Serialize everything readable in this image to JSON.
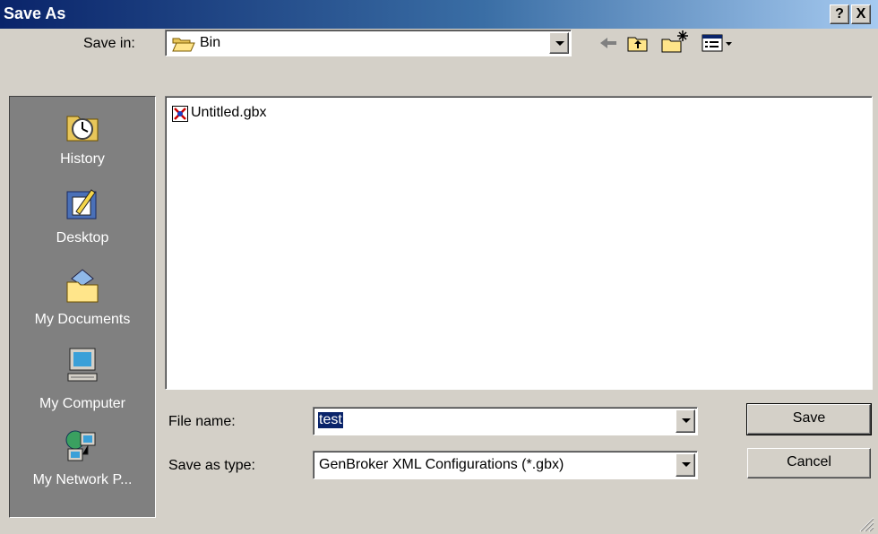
{
  "window": {
    "title": "Save As",
    "help_label": "?",
    "close_label": "X"
  },
  "save_in": {
    "label": "Save in:",
    "value": "Bin"
  },
  "toolbar": {
    "back_icon": "back-arrow-icon",
    "up_icon": "up-folder-icon",
    "new_folder_icon": "new-folder-icon",
    "view_menu_icon": "view-menu-icon"
  },
  "places": [
    {
      "label": "History",
      "icon": "history-icon"
    },
    {
      "label": "Desktop",
      "icon": "desktop-icon"
    },
    {
      "label": "My Documents",
      "icon": "my-documents-icon"
    },
    {
      "label": "My Computer",
      "icon": "my-computer-icon"
    },
    {
      "label": "My Network P...",
      "icon": "my-network-places-icon"
    }
  ],
  "files": [
    {
      "name": "Untitled.gbx",
      "icon": "gbx-file-icon"
    }
  ],
  "file_name": {
    "label": "File name:",
    "value": "test"
  },
  "save_as_type": {
    "label": "Save as type:",
    "value": "GenBroker XML Configurations (*.gbx)"
  },
  "buttons": {
    "save_label": "Save",
    "cancel_label": "Cancel"
  },
  "colors": {
    "title_bar": "#0a246a",
    "face": "#d4d0c8",
    "places_bar": "#808080",
    "selection": "#0a246a"
  }
}
